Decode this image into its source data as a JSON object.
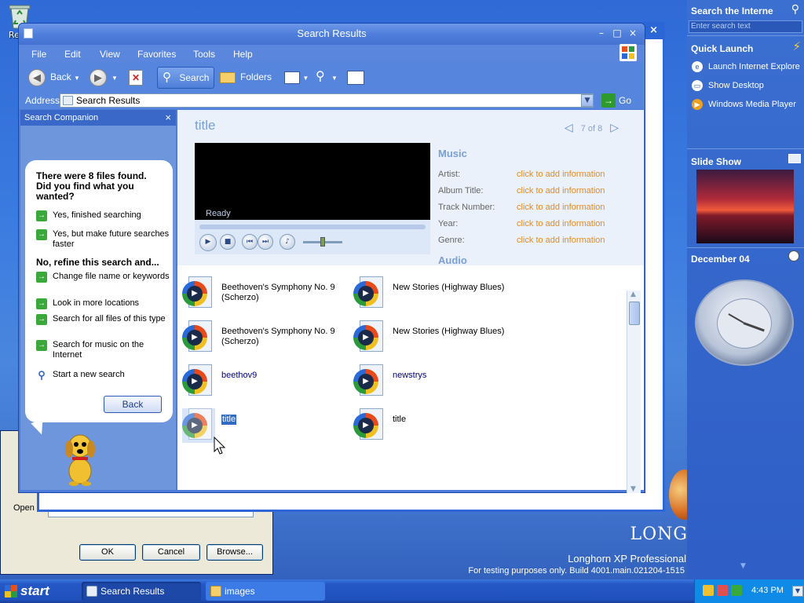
{
  "desktop": {
    "recycle_label": "Re",
    "brand_logo": "LONG",
    "brand_edition": "Longhorn XP Professional",
    "brand_build": "For testing purposes only. Build 4001.main.021204-1515"
  },
  "run_dialog": {
    "open_label": "Open",
    "ok": "OK",
    "cancel": "Cancel",
    "browse": "Browse..."
  },
  "window": {
    "title": "Search Results",
    "menu": [
      "File",
      "Edit",
      "View",
      "Favorites",
      "Tools",
      "Help"
    ],
    "toolbar": {
      "back": "Back",
      "search": "Search",
      "folders": "Folders"
    },
    "address": {
      "label": "Address",
      "value": "Search Results",
      "go": "Go"
    }
  },
  "companion": {
    "header": "Search Companion",
    "found_text": "There were 8 files found. Did you find what you wanted?",
    "options_yes": [
      "Yes, finished searching",
      "Yes, but make future searches faster"
    ],
    "refine_heading": "No, refine this search and...",
    "options_refine": [
      "Change file name or keywords",
      "Look in more locations",
      "Search for all files of this type",
      "Search for music on the Internet"
    ],
    "new_search": "Start a new search",
    "back_button": "Back"
  },
  "preview": {
    "title": "title",
    "counter": "7 of 8",
    "player_status": "Ready",
    "section_music": "Music",
    "section_audio": "Audio",
    "fields": [
      {
        "key": "Artist:",
        "value": "click to add information"
      },
      {
        "key": "Album Title:",
        "value": "click to add information"
      },
      {
        "key": "Track Number:",
        "value": "click to add information"
      },
      {
        "key": "Year:",
        "value": "click to add information"
      },
      {
        "key": "Genre:",
        "value": "click to add information"
      }
    ]
  },
  "files": [
    {
      "name": "Beethoven's Symphony No. 9 (Scherzo)",
      "selected": false,
      "link": false
    },
    {
      "name": "New Stories (Highway Blues)",
      "selected": false,
      "link": false
    },
    {
      "name": "Beethoven's Symphony No. 9 (Scherzo)",
      "selected": false,
      "link": false
    },
    {
      "name": "New Stories (Highway Blues)",
      "selected": false,
      "link": false
    },
    {
      "name": "beethov9",
      "selected": false,
      "link": true
    },
    {
      "name": "newstrys",
      "selected": false,
      "link": true
    },
    {
      "name": "title",
      "selected": true,
      "link": false
    },
    {
      "name": "title",
      "selected": false,
      "link": false
    }
  ],
  "sidebar": {
    "search_heading": "Search the Interne",
    "search_placeholder": "Enter search text",
    "quick_launch_heading": "Quick Launch",
    "quick_launch_items": [
      "Launch Internet Explore",
      "Show Desktop",
      "Windows Media Player"
    ],
    "slideshow_heading": "Slide Show",
    "clock_heading": "December 04"
  },
  "taskbar": {
    "start": "start",
    "tasks": [
      "Search Results",
      "images"
    ],
    "time": "4:43 PM"
  },
  "colors": {
    "accent": "#2b66d6",
    "link_orange": "#e88a1a",
    "section_blue": "#7aa0d6",
    "taskbar": "#2051bd"
  }
}
